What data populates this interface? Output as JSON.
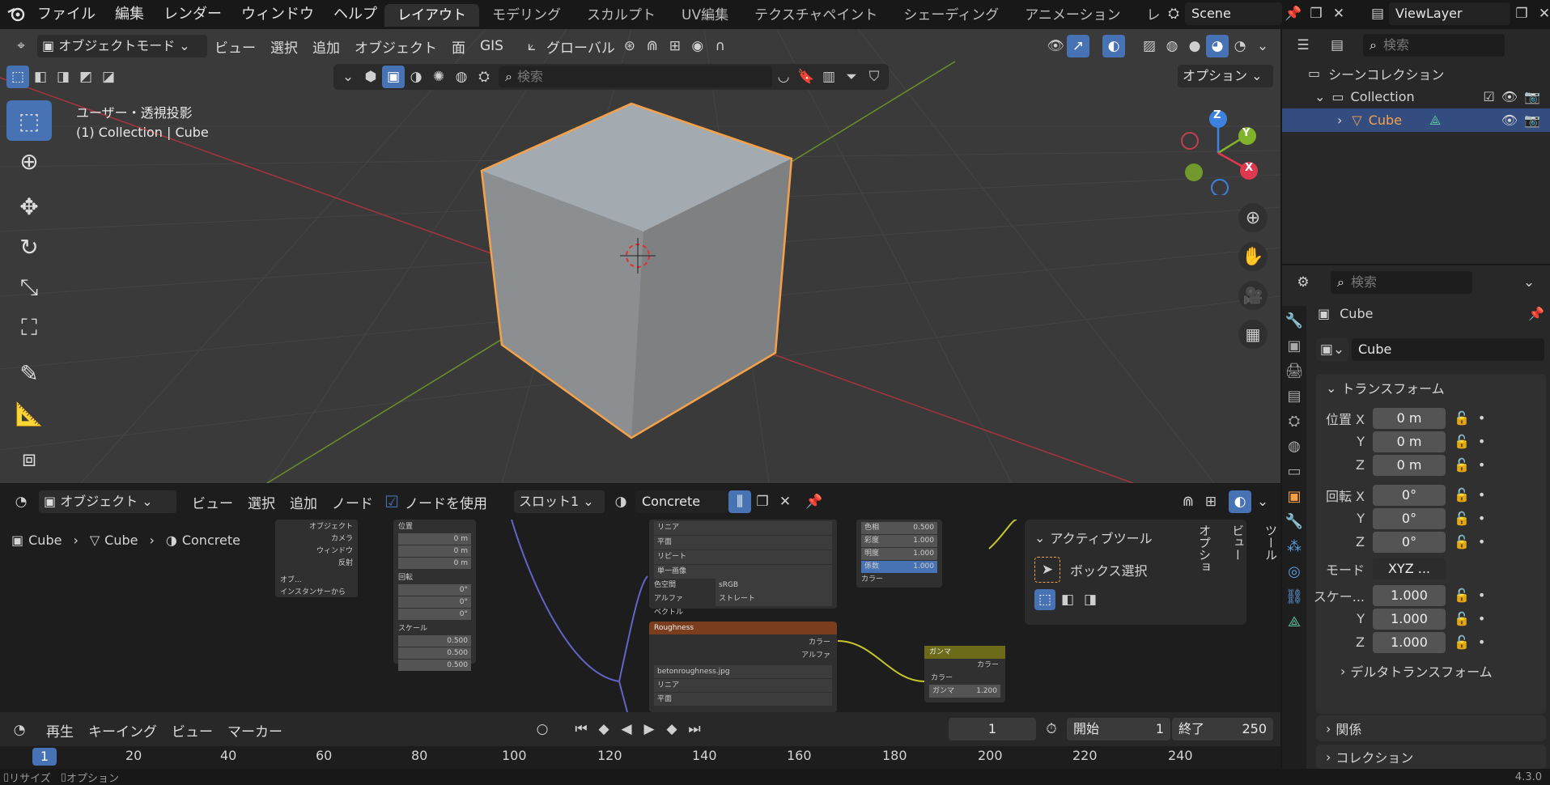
{
  "topbar": {
    "menus": [
      "ファイル",
      "編集",
      "レンダー",
      "ウィンドウ",
      "ヘルプ"
    ],
    "workspaces": [
      "レイアウト",
      "モデリング",
      "スカルプト",
      "UV編集",
      "テクスチャペイント",
      "シェーディング",
      "アニメーション",
      "レ"
    ],
    "active_workspace": "レイアウト",
    "scene": "Scene",
    "view_layer": "ViewLayer"
  },
  "viewport": {
    "mode": "オブジェクトモード",
    "menus": [
      "ビュー",
      "選択",
      "追加",
      "オブジェクト",
      "面",
      "GIS"
    ],
    "orientation": "グローバル",
    "view_name": "ユーザー・透視投影",
    "context": "(1) Collection | Cube",
    "search_placeholder": "検索",
    "options_label": "オプション",
    "gizmo": {
      "x": "X",
      "y": "Y",
      "z": "Z"
    }
  },
  "node_editor": {
    "editor_type": "オブジェクト",
    "menus": [
      "ビュー",
      "選択",
      "追加",
      "ノード"
    ],
    "use_nodes": "ノードを使用",
    "slot": "スロット1",
    "material": "Concrete",
    "breadcrumb": [
      "Cube",
      "Cube",
      "Concrete"
    ],
    "active_tool_title": "アクティブツール",
    "active_tool": "ボックス選択",
    "side_tabs": [
      "ツール",
      "ビュー",
      "オプショ"
    ],
    "nodes": {
      "object_outputs": [
        "オブジェクト",
        "カメラ",
        "ウィンドウ",
        "反射"
      ],
      "object_field": "オブ...",
      "instancer": "インスタンサーから",
      "location": {
        "title": "位置",
        "x": "0 m",
        "y": "0 m",
        "z": "0 m"
      },
      "rotation": {
        "title": "回転",
        "x": "0°",
        "y": "0°",
        "z": "0°"
      },
      "scale": {
        "title": "スケール",
        "x": "0.500",
        "y": "0.500",
        "z": "0.500"
      },
      "image_rows": [
        "リニア",
        "平面",
        "リピート",
        "単一画像"
      ],
      "colorspace_label": "色空間",
      "colorspace": "sRGB",
      "alpha_label": "アルファ",
      "alpha": "ストレート",
      "vector": "ベクトル",
      "roughness_title": "Roughness",
      "roughness_outputs": [
        "カラー",
        "アルファ"
      ],
      "roughness_file": "betonroughness.jpg",
      "roughness_rows": [
        "リニア",
        "平面"
      ],
      "hsv": [
        {
          "k": "色相",
          "v": "0.500"
        },
        {
          "k": "彩度",
          "v": "1.000"
        },
        {
          "k": "明度",
          "v": "1.000"
        },
        {
          "k": "係数",
          "v": "1.000"
        }
      ],
      "hsv_out": "カラー",
      "gamma_title": "ガンマ",
      "gamma_out": "カラー",
      "gamma_in": "カラー",
      "gamma_label": "ガンマ",
      "gamma_value": "1.200"
    }
  },
  "timeline": {
    "menus": [
      "再生",
      "キーイング",
      "ビュー",
      "マーカー"
    ],
    "current_frame": "1",
    "start_label": "開始",
    "start": "1",
    "end_label": "終了",
    "end": "250",
    "ruler": [
      "1",
      "20",
      "40",
      "60",
      "80",
      "100",
      "120",
      "140",
      "160",
      "180",
      "200",
      "220",
      "240"
    ]
  },
  "outliner": {
    "search_placeholder": "検索",
    "scene_collection": "シーンコレクション",
    "collection": "Collection",
    "object": "Cube"
  },
  "properties": {
    "search_placeholder": "検索",
    "object_name": "Cube",
    "data_name": "Cube",
    "transform_title": "トランスフォーム",
    "location_label": "位置 X",
    "rotation_label": "回転 X",
    "scale_label": "スケー...",
    "location": [
      "0 m",
      "0 m",
      "0 m"
    ],
    "rotation": [
      "0°",
      "0°",
      "0°"
    ],
    "mode_label": "モード",
    "mode": "XYZ ...",
    "scale": [
      "1.000",
      "1.000",
      "1.000"
    ],
    "y": "Y",
    "z": "Z",
    "delta": "デルタトランスフォーム",
    "relations": "関係",
    "collections": "コレクション"
  },
  "statusbar": {
    "left1": "リサイズ",
    "left2": "オプション",
    "version": "4.3.0"
  },
  "colors": {
    "accent": "#4772b3",
    "selection": "#f5a14a",
    "x_axis": "#e0384e",
    "y_axis": "#80b22c",
    "z_axis": "#3d82e0"
  }
}
